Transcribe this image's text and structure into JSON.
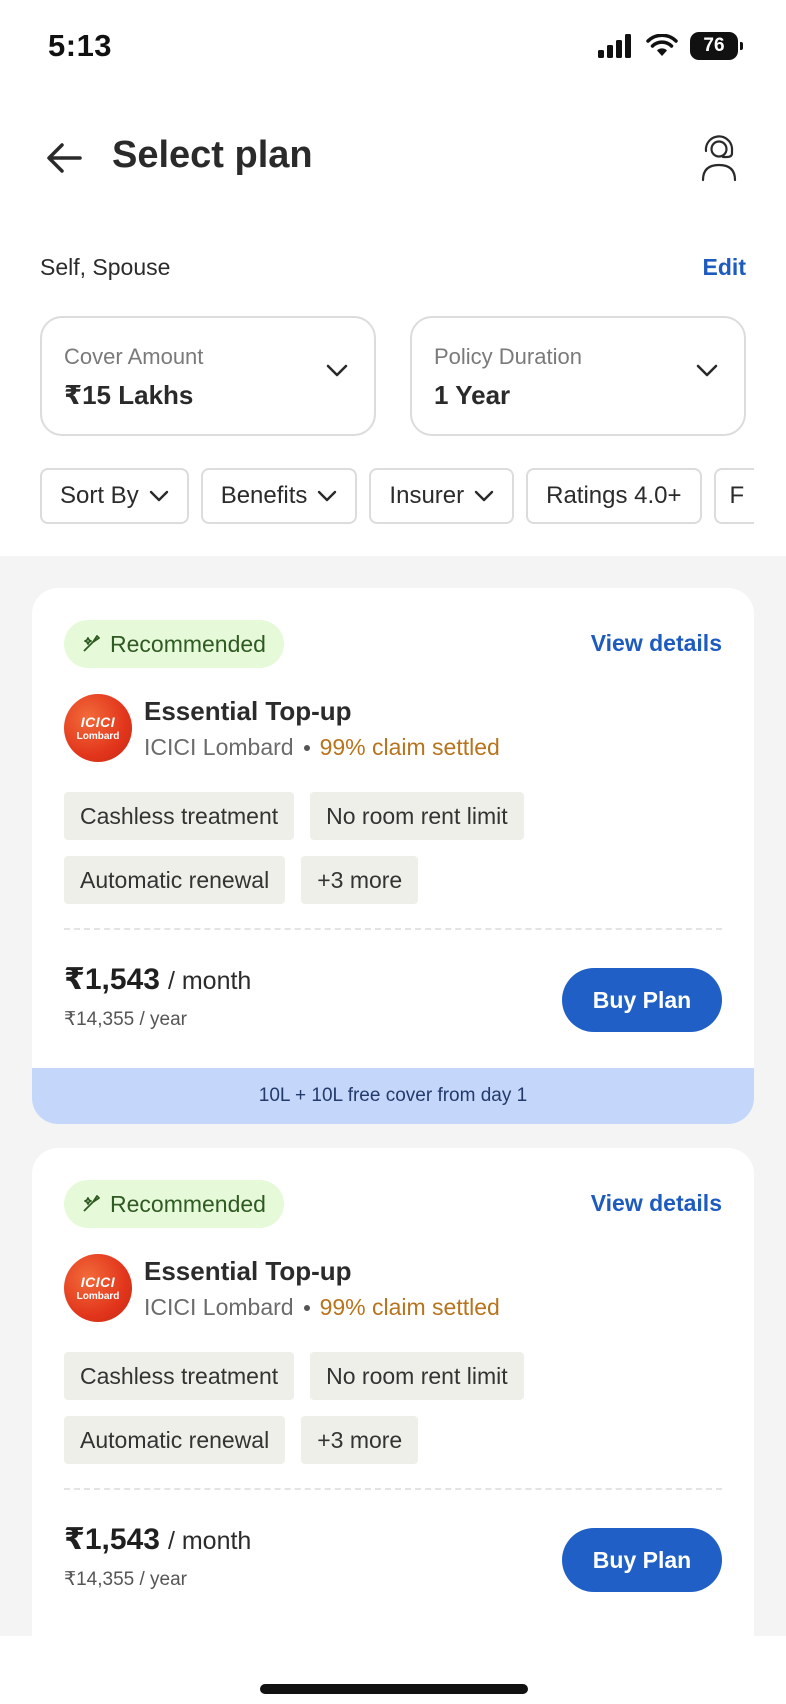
{
  "status_bar": {
    "time": "5:13",
    "battery": "76"
  },
  "header": {
    "title": "Select plan"
  },
  "members": {
    "label": "Self, Spouse",
    "edit_label": "Edit"
  },
  "selectors": {
    "cover": {
      "label": "Cover Amount",
      "value": "₹15 Lakhs"
    },
    "duration": {
      "label": "Policy Duration",
      "value": "1 Year"
    }
  },
  "filters": [
    {
      "label": "Sort By"
    },
    {
      "label": "Benefits"
    },
    {
      "label": "Insurer"
    },
    {
      "label": "Ratings 4.0+"
    },
    {
      "label": "F"
    }
  ],
  "plans": [
    {
      "badge": "Recommended",
      "view_details": "View details",
      "name": "Essential Top-up",
      "insurer": "ICICI Lombard",
      "claim": "99% claim settled",
      "logo_top": "ICICI",
      "logo_bottom": "Lombard",
      "features": [
        "Cashless treatment",
        "No room rent limit",
        "Automatic renewal",
        "+3 more"
      ],
      "price": "₹1,543",
      "price_unit": "/ month",
      "price_year": "₹14,355 / year",
      "buy_label": "Buy Plan",
      "footer": "10L + 10L free cover from day 1"
    },
    {
      "badge": "Recommended",
      "view_details": "View details",
      "name": "Essential Top-up",
      "insurer": "ICICI Lombard",
      "claim": "99% claim settled",
      "logo_top": "ICICI",
      "logo_bottom": "Lombard",
      "features": [
        "Cashless treatment",
        "No room rent limit",
        "Automatic renewal",
        "+3 more"
      ],
      "price": "₹1,543",
      "price_unit": "/ month",
      "price_year": "₹14,355 / year",
      "buy_label": "Buy Plan",
      "footer": ""
    }
  ],
  "colors": {
    "accent": "#1f5fc6",
    "claim": "#b8731d",
    "recommended_bg": "#e6fad9",
    "footer_bg": "#c4d7fb"
  }
}
